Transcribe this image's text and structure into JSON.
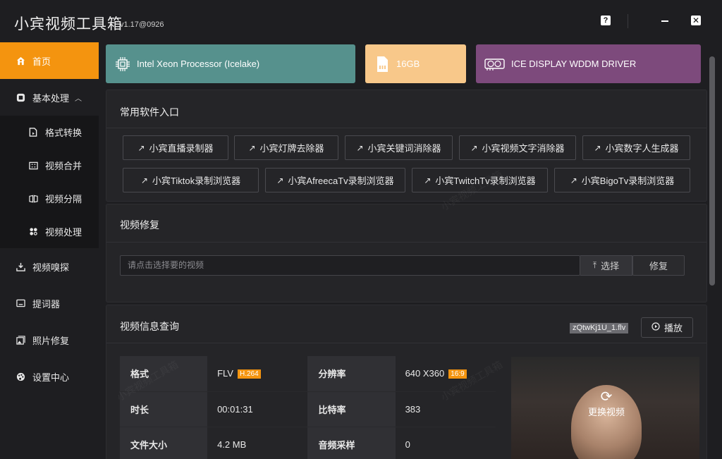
{
  "app": {
    "title": "小宾视频工具箱",
    "version": "v1.17@0926"
  },
  "titlebar": {
    "help": "?",
    "close": "✕"
  },
  "sidebar": {
    "items": [
      {
        "label": "首页",
        "icon": "home-icon"
      },
      {
        "label": "基本处理",
        "icon": "box-icon",
        "chevron": "︿"
      },
      {
        "label": "格式转换",
        "icon": "file-convert-icon"
      },
      {
        "label": "视频合并",
        "icon": "merge-icon"
      },
      {
        "label": "视频分隔",
        "icon": "split-icon"
      },
      {
        "label": "视频处理",
        "icon": "process-icon"
      },
      {
        "label": "视频嗅探",
        "icon": "download-icon"
      },
      {
        "label": "提词器",
        "icon": "teleprompter-icon"
      },
      {
        "label": "照片修复",
        "icon": "photo-icon"
      },
      {
        "label": "设置中心",
        "icon": "palette-icon"
      }
    ]
  },
  "hardware": {
    "cpu": "Intel Xeon Processor (Icelake)",
    "memory": "16GB",
    "gpu": "ICE DISPLAY WDDM DRIVER"
  },
  "software": {
    "title": "常用软件入口",
    "row1": [
      "小宾直播录制器",
      "小宾灯牌去除器",
      "小宾关键词消除器",
      "小宾视频文字消除器",
      "小宾数字人生成器"
    ],
    "row2": [
      "小宾Tiktok录制浏览器",
      "小宾AfreecaTv录制浏览器",
      "小宾TwitchTv录制浏览器",
      "小宾BigoTv录制浏览器"
    ]
  },
  "repair": {
    "title": "视频修复",
    "placeholder": "请点击选择要的视频",
    "select_label": "选择",
    "repair_label": "修复"
  },
  "info": {
    "title": "视频信息查询",
    "file_name": "zQtwKj1U_1.flv",
    "play_label": "播放",
    "rows": [
      {
        "k1": "格式",
        "v1": "FLV",
        "b1": "H.264",
        "k2": "分辨率",
        "v2": "640 X360",
        "b2": "16:9"
      },
      {
        "k1": "时长",
        "v1": "00:01:31",
        "k2": "比特率",
        "v2": "383"
      },
      {
        "k1": "文件大小",
        "v1": "4.2 MB",
        "k2": "音频采样",
        "v2": "0"
      }
    ],
    "change_video": "更换视频",
    "watermark": "小宾视频工具箱"
  },
  "colors": {
    "accent": "#f4940f",
    "cpu": "#56918d",
    "memory": "#f8c88a",
    "gpu": "#7d4a7c"
  }
}
